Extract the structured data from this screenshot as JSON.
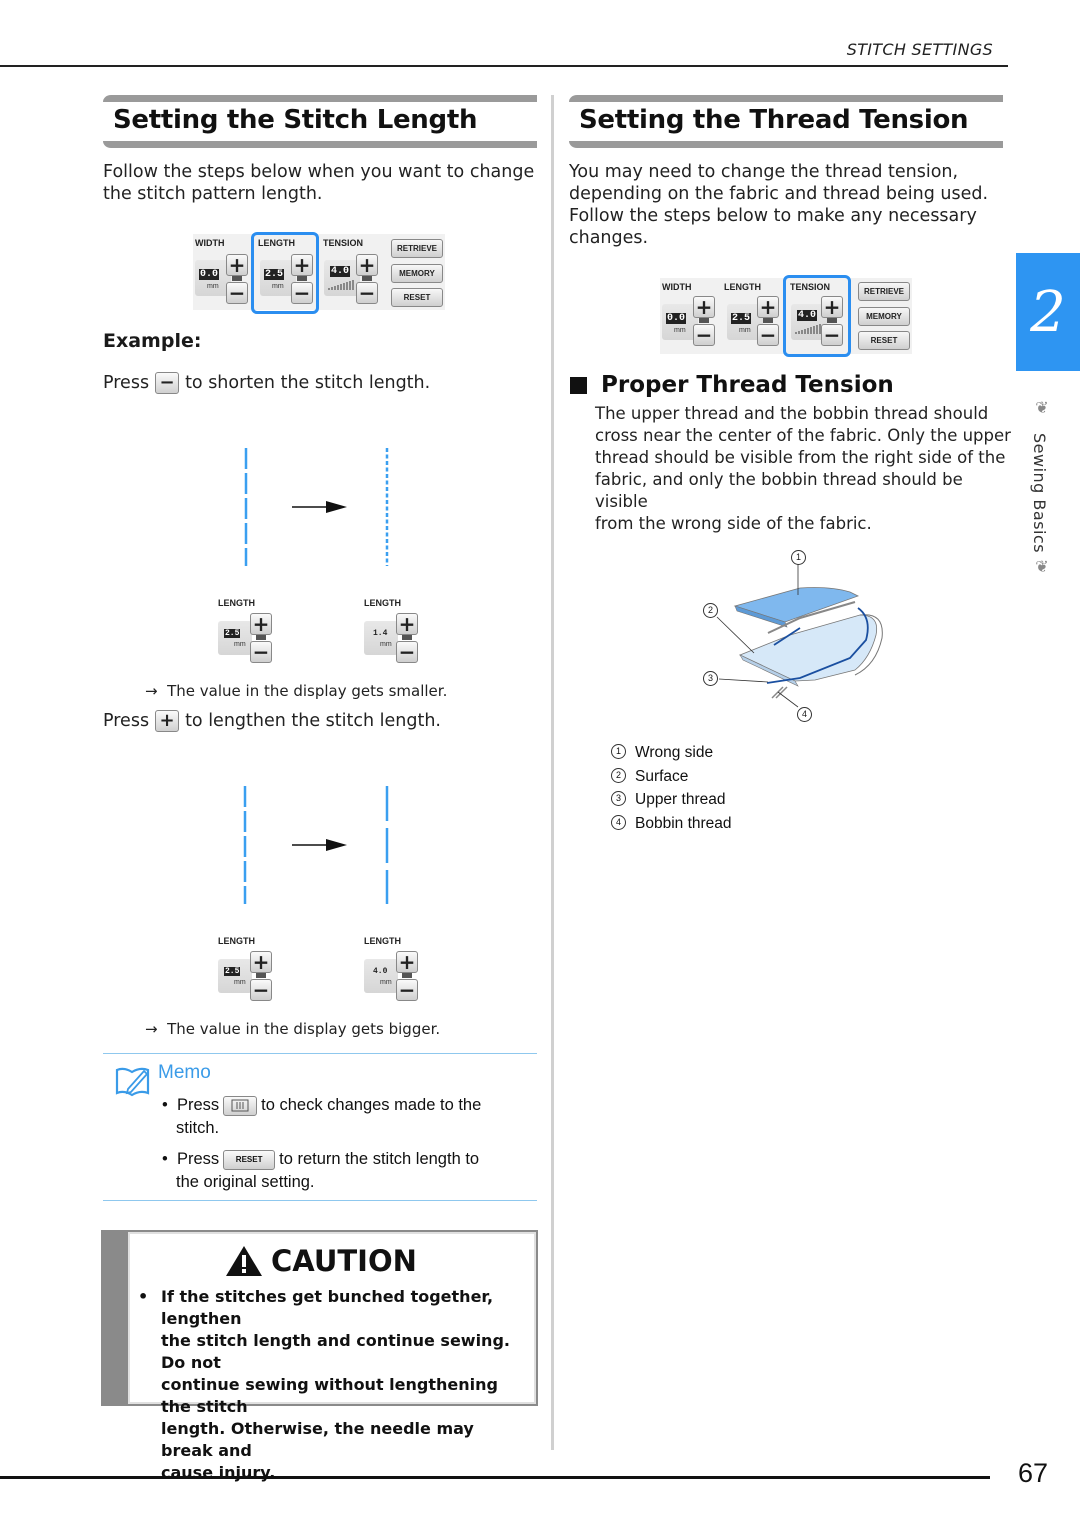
{
  "running_head": "STITCH SETTINGS",
  "page_number": "67",
  "chapter": {
    "number": "2",
    "title": "Sewing Basics",
    "ornament_icon": "fleur-ornament"
  },
  "left": {
    "title": "Setting the Stitch Length",
    "intro": "Follow the steps below when you want to change the stitch pattern length.",
    "panel": {
      "width_label": "WIDTH",
      "length_label": "LENGTH",
      "tension_label": "TENSION",
      "width_value": "0.0",
      "length_value": "2.5",
      "tension_value": "4.0",
      "unit": "mm",
      "retrieve": "RETRIEVE",
      "memory": "MEMORY",
      "reset": "RESET",
      "plus": "+",
      "minus": "−",
      "highlighted": "LENGTH"
    },
    "example_label": "Example:",
    "shorten": {
      "press": "Press",
      "button_icon": "minus",
      "button": "−",
      "text": "to shorten the stitch length.",
      "before_value": "2.5",
      "after_value": "1.4",
      "result": "The value in the display gets smaller."
    },
    "lengthen": {
      "press": "Press",
      "button_icon": "plus",
      "button": "+",
      "text": "to lengthen the stitch length.",
      "before_value": "2.5",
      "after_value": "4.0",
      "result": "The value in the display gets bigger."
    },
    "arrow": "→",
    "mini_label": "LENGTH",
    "unit": "mm",
    "memo": {
      "title": "Memo",
      "items": [
        {
          "bullet": "•",
          "before": "Press",
          "button_icon": "image-preview",
          "after": "to check changes made to the",
          "cont": "stitch."
        },
        {
          "bullet": "•",
          "before": "Press",
          "button": "RESET",
          "after": "to return the stitch length to",
          "cont": "the original setting."
        }
      ]
    },
    "caution": {
      "title": "CAUTION",
      "bullet": "•",
      "lines": [
        "If the stitches get bunched together, lengthen",
        "the stitch length and continue sewing. Do not",
        "continue sewing without lengthening the stitch",
        "length. Otherwise, the needle may break and",
        "cause injury."
      ]
    }
  },
  "right": {
    "title": "Setting the Thread Tension",
    "intro_lines": [
      "You may need to change the thread tension,",
      "depending on the fabric and thread being used.",
      "Follow the steps below to make any necessary",
      "changes."
    ],
    "panel": {
      "width_label": "WIDTH",
      "length_label": "LENGTH",
      "tension_label": "TENSION",
      "width_value": "0.0",
      "length_value": "2.5",
      "tension_value": "4.0",
      "unit": "mm",
      "retrieve": "RETRIEVE",
      "memory": "MEMORY",
      "reset": "RESET",
      "plus": "+",
      "minus": "−",
      "highlighted": "TENSION"
    },
    "subsection": {
      "title": "Proper Thread Tension",
      "lines": [
        "The upper thread and the bobbin thread should",
        "cross near the center of the fabric. Only the upper",
        "thread should be visible from the right side of the",
        "fabric, and only the bobbin thread should be visible",
        "from the wrong side of the fabric."
      ]
    },
    "callouts": [
      "1",
      "2",
      "3",
      "4"
    ],
    "legend": [
      {
        "num": "1",
        "label": "Wrong side"
      },
      {
        "num": "2",
        "label": "Surface"
      },
      {
        "num": "3",
        "label": "Upper thread"
      },
      {
        "num": "4",
        "label": "Bobbin thread"
      }
    ]
  },
  "colors": {
    "accent": "#2e95f2",
    "stitch": "#3a9ff0",
    "fabric_top": "#7fb8ee",
    "fabric_bottom": "#cfe3f7",
    "header_bar": "#9a9a9a"
  }
}
